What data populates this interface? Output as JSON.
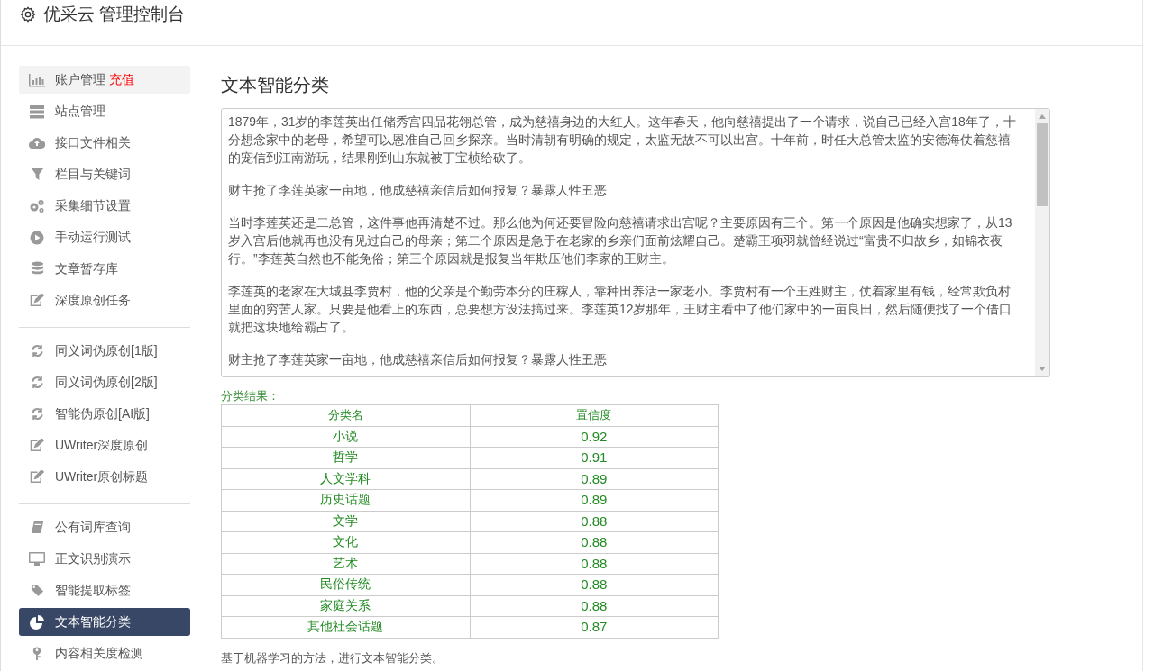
{
  "header": {
    "title": "优采云 管理控制台"
  },
  "sidebar": {
    "groups": [
      {
        "items": [
          {
            "label": "账户管理",
            "badge": "充值",
            "kind": "chart",
            "selected": false,
            "hover": true
          },
          {
            "label": "站点管理",
            "kind": "server",
            "selected": false,
            "hover": false
          },
          {
            "label": "接口文件相关",
            "kind": "cloud",
            "selected": false,
            "hover": false
          },
          {
            "label": "栏目与关键词",
            "kind": "filter",
            "selected": false,
            "hover": false
          },
          {
            "label": "采集细节设置",
            "kind": "gears",
            "selected": false,
            "hover": false
          },
          {
            "label": "手动运行测试",
            "kind": "play",
            "selected": false,
            "hover": false
          },
          {
            "label": "文章暂存库",
            "kind": "database",
            "selected": false,
            "hover": false
          },
          {
            "label": "深度原创任务",
            "kind": "edit",
            "selected": false,
            "hover": false
          }
        ]
      },
      {
        "items": [
          {
            "label": "同义词伪原创[1版]",
            "kind": "refresh",
            "selected": false,
            "hover": false
          },
          {
            "label": "同义词伪原创[2版]",
            "kind": "refresh",
            "selected": false,
            "hover": false
          },
          {
            "label": "智能伪原创[AI版]",
            "kind": "refresh",
            "selected": false,
            "hover": false
          },
          {
            "label": "UWriter深度原创",
            "kind": "edit",
            "selected": false,
            "hover": false
          },
          {
            "label": "UWriter原创标题",
            "kind": "edit",
            "selected": false,
            "hover": false
          }
        ]
      },
      {
        "items": [
          {
            "label": "公有词库查询",
            "kind": "book",
            "selected": false,
            "hover": false
          },
          {
            "label": "正文识别演示",
            "kind": "monitor",
            "selected": false,
            "hover": false
          },
          {
            "label": "智能提取标签",
            "kind": "tag",
            "selected": false,
            "hover": false
          },
          {
            "label": "文本智能分类",
            "kind": "pie",
            "selected": true,
            "hover": false
          },
          {
            "label": "内容相关度检测",
            "kind": "key",
            "selected": false,
            "hover": false
          }
        ]
      }
    ]
  },
  "main": {
    "title": "文本智能分类",
    "text_input": {
      "paragraphs": [
        "1879年，31岁的李莲英出任储秀宫四品花翎总管，成为慈禧身边的大红人。这年春天，他向慈禧提出了一个请求，说自己已经入宫18年了，十分想念家中的老母，希望可以恩准自己回乡探亲。当时清朝有明确的规定，太监无故不可以出宫。十年前，时任大总管太监的安德海仗着慈禧的宠信到江南游玩，结果刚到山东就被丁宝桢给砍了。",
        "财主抢了李莲英家一亩地，他成慈禧亲信后如何报复？暴露人性丑恶",
        "当时李莲英还是二总管，这件事他再清楚不过。那么他为何还要冒险向慈禧请求出宫呢？主要原因有三个。第一个原因是他确实想家了，从13岁入宫后他就再也没有见过自己的母亲；第二个原因是急于在老家的乡亲们面前炫耀自己。楚霸王项羽就曾经说过“富贵不归故乡，如锦衣夜行。”李莲英自然也不能免俗；第三个原因就是报复当年欺压他们李家的王财主。",
        "李莲英的老家在大城县李贾村，他的父亲是个勤劳本分的庄稼人，靠种田养活一家老小。李贾村有一个王姓财主，仗着家里有钱，经常欺负村里面的穷苦人家。只要是他看上的东西，总要想方设法搞过来。李莲英12岁那年，王财主看中了他们家中的一亩良田，然后随便找了一个借口就把这块地给霸占了。",
        "财主抢了李莲英家一亩地，他成慈禧亲信后如何报复？暴露人性丑恶"
      ]
    },
    "result_label": "分类结果：",
    "table": {
      "columns": [
        "分类名",
        "置信度"
      ],
      "rows": [
        [
          "小说",
          "0.92"
        ],
        [
          "哲学",
          "0.91"
        ],
        [
          "人文学科",
          "0.89"
        ],
        [
          "历史话题",
          "0.89"
        ],
        [
          "文学",
          "0.88"
        ],
        [
          "文化",
          "0.88"
        ],
        [
          "艺术",
          "0.88"
        ],
        [
          "民俗传统",
          "0.88"
        ],
        [
          "家庭关系",
          "0.88"
        ],
        [
          "其他社会话题",
          "0.87"
        ]
      ]
    },
    "description": "基于机器学习的方法，进行文本智能分类。"
  }
}
